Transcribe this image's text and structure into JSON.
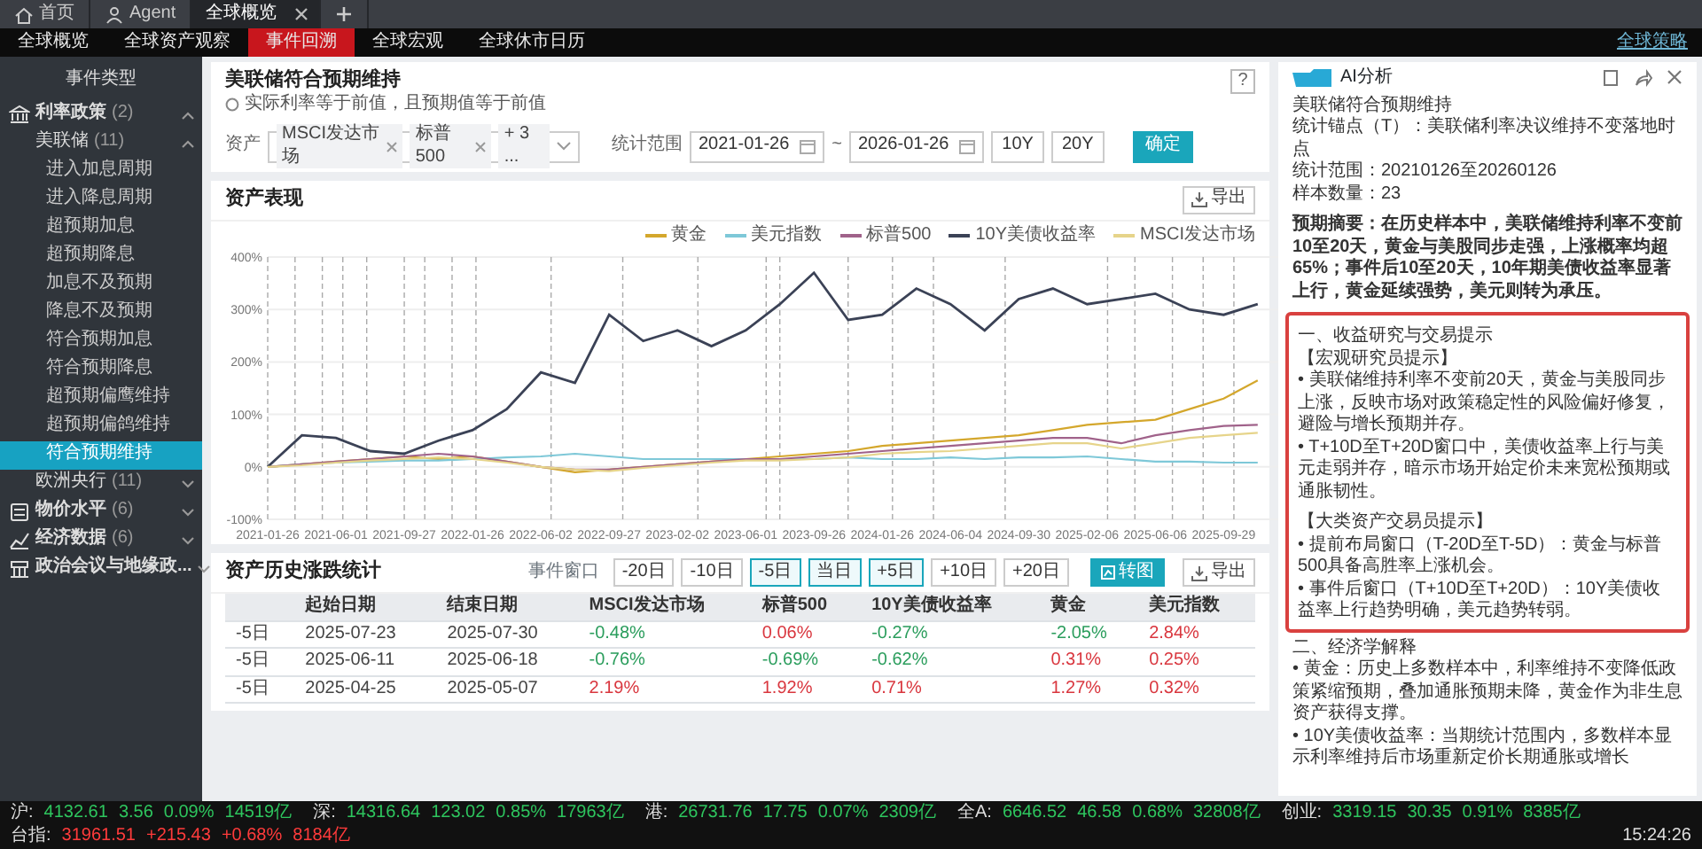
{
  "top_tabs": [
    {
      "label": "首页",
      "kind": "home",
      "selected": false,
      "closable": false
    },
    {
      "label": "Agent",
      "kind": "agent",
      "selected": false,
      "closable": false
    },
    {
      "label": "全球概览",
      "kind": "page",
      "selected": true,
      "closable": true
    }
  ],
  "nav": {
    "items": [
      {
        "label": "全球概览",
        "selected": false
      },
      {
        "label": "全球资产观察",
        "selected": false
      },
      {
        "label": "事件回溯",
        "selected": true
      },
      {
        "label": "全球宏观",
        "selected": false
      },
      {
        "label": "全球休市日历",
        "selected": false
      }
    ],
    "right_link": "全球策略"
  },
  "sidebar": {
    "title": "事件类型",
    "items": [
      {
        "label": "利率政策",
        "count": "(2)",
        "kind": "rates",
        "expanded": true,
        "children": [
          {
            "label": "美联储",
            "count": "(11)",
            "expanded": true,
            "children": [
              {
                "label": "进入加息周期",
                "selected": false
              },
              {
                "label": "进入降息周期",
                "selected": false
              },
              {
                "label": "超预期加息",
                "selected": false
              },
              {
                "label": "超预期降息",
                "selected": false
              },
              {
                "label": "加息不及预期",
                "selected": false
              },
              {
                "label": "降息不及预期",
                "selected": false
              },
              {
                "label": "符合预期加息",
                "selected": false
              },
              {
                "label": "符合预期降息",
                "selected": false
              },
              {
                "label": "超预期偏鹰维持",
                "selected": false
              },
              {
                "label": "超预期偏鸽维持",
                "selected": false
              },
              {
                "label": "符合预期维持",
                "selected": true
              }
            ]
          },
          {
            "label": "欧洲央行",
            "count": "(11)",
            "expanded": false
          }
        ]
      },
      {
        "label": "物价水平",
        "count": "(6)",
        "kind": "prices",
        "expanded": false
      },
      {
        "label": "经济数据",
        "count": "(6)",
        "kind": "economy",
        "expanded": false
      },
      {
        "label": "政治会议与地缘政...",
        "kind": "politics",
        "expanded": false
      }
    ]
  },
  "event": {
    "title": "美联储符合预期维持",
    "hint": "实际利率等于前值，且预期值等于前值",
    "help": "?"
  },
  "filters": {
    "asset_label": "资产",
    "tags": [
      "MSCI发达市场",
      "标普500"
    ],
    "more": "+ 3 ...",
    "range_label": "统计范围",
    "start": "2021-01-26",
    "separator": "~",
    "end": "2026-01-26",
    "presets": [
      "10Y",
      "20Y"
    ],
    "confirm": "确定"
  },
  "chart_card": {
    "title": "资产表现",
    "export": "导出",
    "chart_data": {
      "type": "line",
      "categories": [
        "2021-01-26",
        null,
        "2021-06-01",
        null,
        "2021-09-27",
        null,
        "2022-01-26",
        null,
        "2022-06-02",
        null,
        "2022-09-27",
        null,
        "2023-02-02",
        null,
        "2023-06-01",
        null,
        "2023-09-26",
        null,
        "2024-01-26",
        null,
        "2024-06-04",
        null,
        "2024-09-30",
        null,
        "2025-02-06",
        null,
        "2025-06-06",
        null,
        "2025-09-29",
        null
      ],
      "ylim": [
        -100,
        400
      ],
      "yticks": [
        {
          "value": -100,
          "label": "-100%"
        },
        {
          "value": 0,
          "label": "0%"
        },
        {
          "value": 100,
          "label": "100%"
        },
        {
          "value": 200,
          "label": "200%"
        },
        {
          "value": 300,
          "label": "300%"
        },
        {
          "value": 400,
          "label": "400%"
        }
      ],
      "series": [
        {
          "name": "黄金",
          "color": "#d4a72c",
          "values": [
            0,
            5,
            10,
            15,
            20,
            15,
            20,
            10,
            0,
            -10,
            -5,
            0,
            5,
            10,
            15,
            20,
            25,
            30,
            40,
            45,
            50,
            55,
            60,
            70,
            80,
            85,
            90,
            110,
            130,
            165
          ]
        },
        {
          "name": "美元指数",
          "color": "#7ec8d8",
          "values": [
            0,
            5,
            8,
            10,
            12,
            12,
            15,
            18,
            20,
            25,
            20,
            15,
            15,
            15,
            15,
            15,
            15,
            18,
            15,
            15,
            18,
            15,
            18,
            18,
            20,
            15,
            10,
            10,
            8,
            8
          ]
        },
        {
          "name": "标普500",
          "color": "#a0628a",
          "values": [
            0,
            5,
            10,
            15,
            20,
            25,
            20,
            10,
            0,
            -5,
            -5,
            0,
            5,
            10,
            15,
            15,
            20,
            25,
            30,
            35,
            40,
            45,
            50,
            55,
            55,
            45,
            60,
            70,
            78,
            80
          ]
        },
        {
          "name": "10Y美债收益率",
          "color": "#3b4256",
          "values": [
            0,
            60,
            55,
            30,
            25,
            50,
            70,
            110,
            180,
            160,
            290,
            240,
            260,
            230,
            260,
            310,
            370,
            280,
            290,
            340,
            310,
            260,
            320,
            340,
            310,
            320,
            330,
            300,
            290,
            310
          ]
        },
        {
          "name": "MSCI发达市场",
          "color": "#e6d48a",
          "values": [
            0,
            3,
            8,
            12,
            15,
            18,
            15,
            8,
            0,
            -5,
            -8,
            -2,
            3,
            8,
            12,
            12,
            15,
            18,
            25,
            28,
            30,
            35,
            40,
            45,
            45,
            35,
            45,
            55,
            60,
            65
          ]
        }
      ],
      "grid": true
    }
  },
  "stats": {
    "title": "资产历史涨跌统计",
    "window_label": "事件窗口",
    "windows": [
      {
        "label": "-20日",
        "selected": false
      },
      {
        "label": "-10日",
        "selected": false
      },
      {
        "label": "-5日",
        "selected": true
      },
      {
        "label": "当日",
        "selected": true
      },
      {
        "label": "+5日",
        "selected": true
      },
      {
        "label": "+10日",
        "selected": false
      },
      {
        "label": "+20日",
        "selected": false
      }
    ],
    "chart_button": "转图",
    "export": "导出",
    "columns": [
      "起始日期",
      "结束日期",
      "MSCI发达市场",
      "标普500",
      "10Y美债收益率",
      "黄金",
      "美元指数"
    ],
    "rows": [
      {
        "window": "-5日",
        "start": "2025-07-23",
        "end": "2025-07-30",
        "values": [
          {
            "text": "-0.48%",
            "color": "#2a9d5c"
          },
          {
            "text": "0.06%",
            "color": "#d9363e"
          },
          {
            "text": "-0.27%",
            "color": "#2a9d5c"
          },
          {
            "text": "-2.05%",
            "color": "#2a9d5c"
          },
          {
            "text": "2.84%",
            "color": "#d9363e"
          }
        ]
      },
      {
        "window": "-5日",
        "start": "2025-06-11",
        "end": "2025-06-18",
        "values": [
          {
            "text": "-0.76%",
            "color": "#2a9d5c"
          },
          {
            "text": "-0.69%",
            "color": "#2a9d5c"
          },
          {
            "text": "-0.62%",
            "color": "#2a9d5c"
          },
          {
            "text": "0.31%",
            "color": "#d9363e"
          },
          {
            "text": "0.25%",
            "color": "#d9363e"
          }
        ]
      },
      {
        "window": "-5日",
        "start": "2025-04-25",
        "end": "2025-05-07",
        "values": [
          {
            "text": "2.19%",
            "color": "#d9363e"
          },
          {
            "text": "1.92%",
            "color": "#d9363e"
          },
          {
            "text": "0.71%",
            "color": "#d9363e"
          },
          {
            "text": "1.27%",
            "color": "#d9363e"
          },
          {
            "text": "0.32%",
            "color": "#d9363e"
          }
        ]
      }
    ]
  },
  "ai_panel": {
    "title": "AI分析",
    "blocks": [
      {
        "kind": "text",
        "text": "美联储符合预期维持"
      },
      {
        "kind": "text",
        "text": "统计锚点（T）：美联储利率决议维持不变落地时点"
      },
      {
        "kind": "text",
        "text": "统计范围：20210126至20260126"
      },
      {
        "kind": "text",
        "text": "样本数量：23"
      },
      {
        "kind": "summary",
        "text": "预期摘要：在历史样本中，美联储维持利率不变前10至20天，黄金与美股同步走强，上涨概率均超65%；事件后10至20天，10年期美债收益率显著上行，黄金延续强势，美元则转为承压。"
      },
      {
        "kind": "boxed",
        "lines": [
          {
            "kind": "heading",
            "text": "一、收益研究与交易提示"
          },
          {
            "kind": "label",
            "text": "【宏观研究员提示】"
          },
          {
            "kind": "bullet",
            "text": "• 美联储维持利率不变前20天，黄金与美股同步上涨，反映市场对政策稳定性的风险偏好修复，避险与增长预期并存。"
          },
          {
            "kind": "bullet",
            "text": "• T+10D至T+20D窗口中，美债收益率上行与美元走弱并存，暗示市场开始定价未来宽松预期或通胀韧性。"
          },
          {
            "kind": "label",
            "text": "【大类资产交易员提示】"
          },
          {
            "kind": "bullet",
            "text": "• 提前布局窗口（T-20D至T-5D）：黄金与标普500具备高胜率上涨机会。"
          },
          {
            "kind": "bullet",
            "text": "• 事件后窗口（T+10D至T+20D）：10Y美债收益率上行趋势明确，美元趋势转弱。"
          }
        ]
      },
      {
        "kind": "heading",
        "text": "二、经济学解释"
      },
      {
        "kind": "bullet",
        "text": "• 黄金：历史上多数样本中，利率维持不变降低政策紧缩预期，叠加通胀预期未降，黄金作为非生息资产获得支撑。"
      },
      {
        "kind": "bullet",
        "text": "• 10Y美债收益率：当期统计范围内，多数样本显示利率维持后市场重新定价长期通胀或增长"
      }
    ]
  },
  "ticker": {
    "items": [
      {
        "label": "沪:",
        "values": [
          "4132.61",
          "3.56",
          "0.09%",
          "14519亿"
        ],
        "color": "#2ec55e"
      },
      {
        "label": "深:",
        "values": [
          "14316.64",
          "123.02",
          "0.85%",
          "17963亿"
        ],
        "color": "#2ec55e"
      },
      {
        "label": "港:",
        "values": [
          "26731.76",
          "17.75",
          "0.07%",
          "2309亿"
        ],
        "color": "#2ec55e"
      },
      {
        "label": "全A:",
        "values": [
          "6646.52",
          "46.58",
          "0.68%",
          "32808亿"
        ],
        "color": "#2ec55e"
      },
      {
        "label": "创业:",
        "values": [
          "3319.15",
          "30.35",
          "0.91%",
          "8385亿"
        ],
        "color": "#2ec55e"
      },
      {
        "label": "台指:",
        "values": [
          "31961.51",
          "+215.43",
          "+0.68%",
          "8184亿"
        ],
        "color": "#ff3b3b"
      }
    ],
    "time": "15:24:26"
  }
}
